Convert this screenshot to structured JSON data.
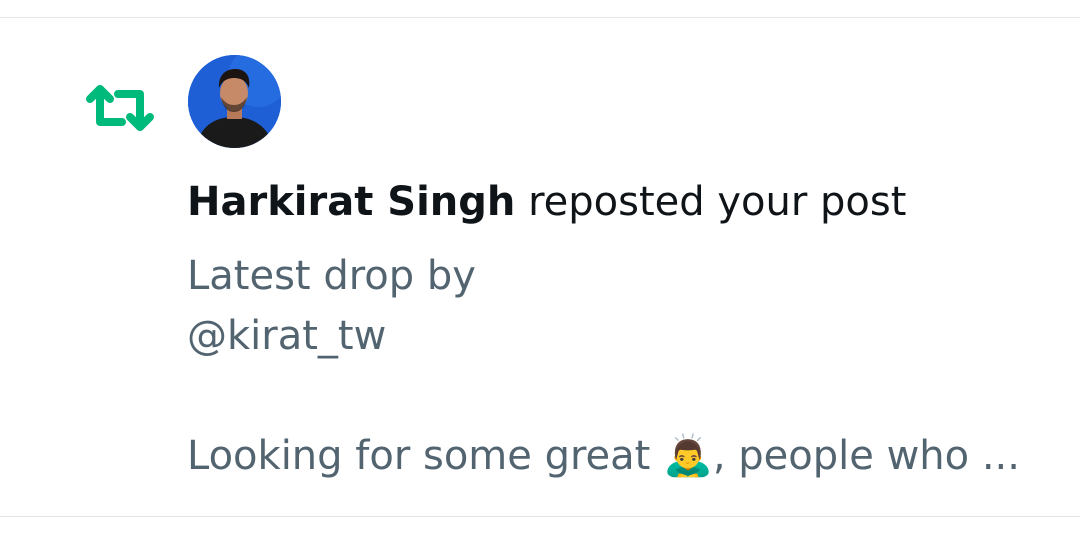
{
  "notification": {
    "type_icon": "repost-icon",
    "accent_color": "#00ba7c",
    "avatar_icon": "avatar",
    "actor_name": "Harkirat Singh",
    "action_text": "reposted your post",
    "preview_lines": [
      "Latest drop by",
      "@kirat_tw",
      "",
      "Looking for some great 🙇‍♂️, people who ..."
    ]
  },
  "colors": {
    "name_text": "#0f1419",
    "secondary_text": "#536471",
    "divider": "#e1e6ea"
  }
}
